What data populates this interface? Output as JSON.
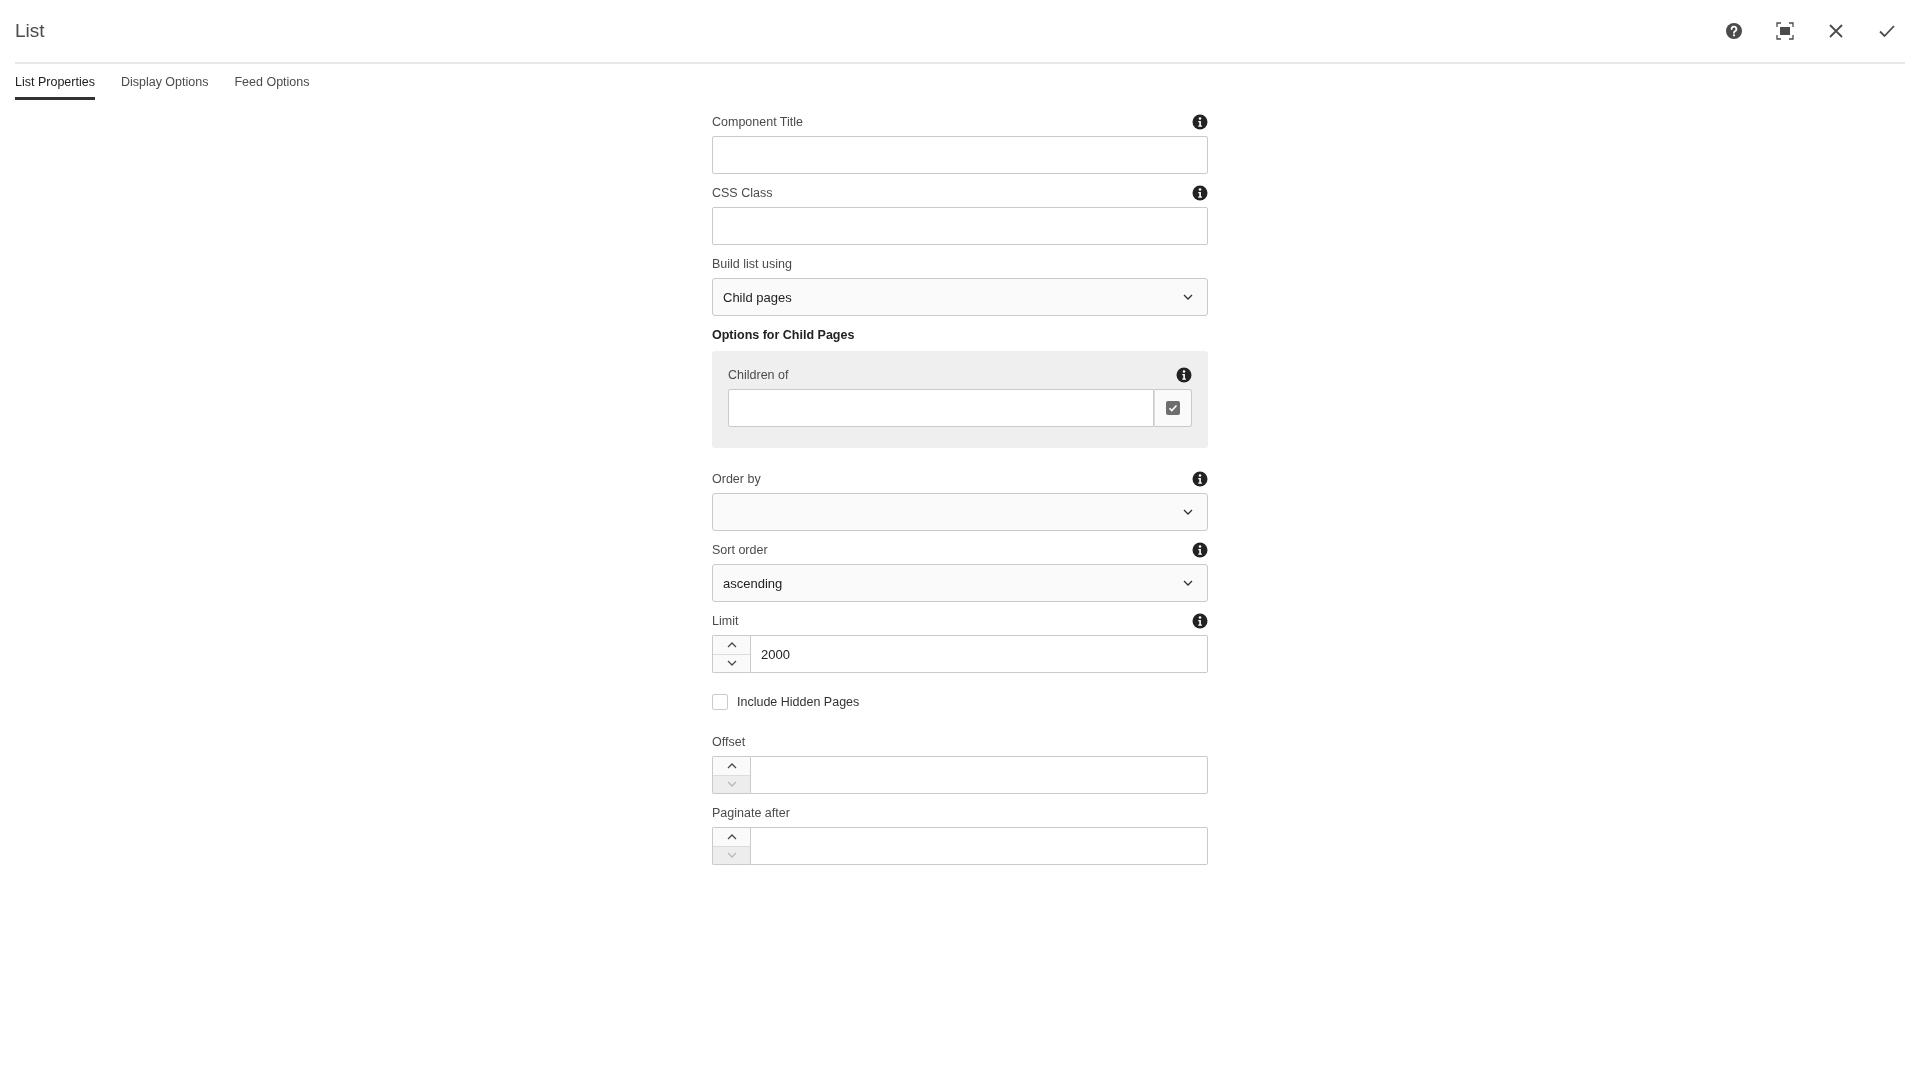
{
  "window": {
    "title": "List"
  },
  "header_actions": [
    {
      "kind": "help"
    },
    {
      "kind": "fullscreen"
    },
    {
      "kind": "close"
    },
    {
      "kind": "done"
    }
  ],
  "tabs": [
    {
      "label": "List Properties",
      "selected": true
    },
    {
      "label": "Display Options",
      "selected": false
    },
    {
      "label": "Feed Options",
      "selected": false
    }
  ],
  "fields": [
    {
      "kind": "text",
      "label": "Component Title",
      "info": true
    },
    {
      "kind": "text",
      "label": "CSS Class",
      "info": true
    },
    {
      "kind": "select",
      "label": "Build list using",
      "value": "Child pages",
      "info": false
    },
    {
      "kind": "group",
      "label": "Options for Child Pages",
      "fields": [
        {
          "kind": "pathfield",
          "label": "Children of",
          "info": true
        }
      ]
    },
    {
      "kind": "select",
      "label": "Order by",
      "info": true
    },
    {
      "kind": "select",
      "label": "Sort order",
      "value": "ascending",
      "info": true
    },
    {
      "kind": "number",
      "label": "Limit",
      "value": "2000",
      "info": true,
      "down_disabled": false
    },
    {
      "kind": "checkbox",
      "label": "Include Hidden Pages",
      "checked": false
    },
    {
      "kind": "number",
      "label": "Offset",
      "info": false,
      "down_disabled": true
    },
    {
      "kind": "number",
      "label": "Paginate after",
      "info": false,
      "down_disabled": true
    }
  ]
}
